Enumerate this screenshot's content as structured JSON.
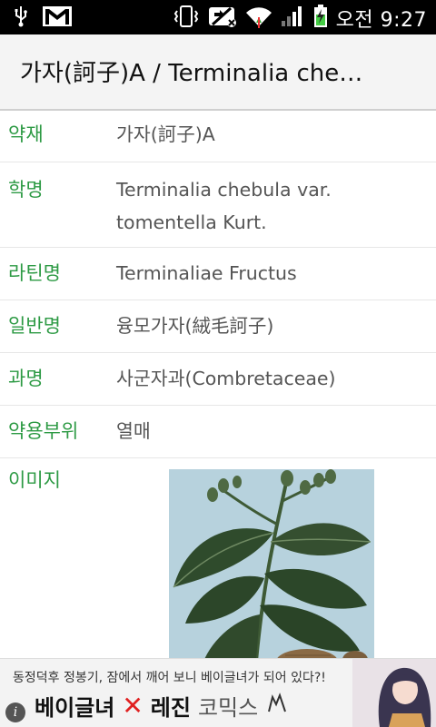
{
  "status_bar": {
    "time": "오전 9:27",
    "icons": [
      "usb-icon",
      "gmail-icon",
      "vibrate-icon",
      "no-sync-icon",
      "wifi-icon",
      "signal-icon",
      "battery-charging-icon"
    ]
  },
  "action_bar": {
    "title": "가자(訶子)A  / Terminalia che…"
  },
  "rows": [
    {
      "label": "약재",
      "value": "가자(訶子)A"
    },
    {
      "label": "학명",
      "value_line1": "Terminalia chebula var.",
      "value_line2": "tomentella Kurt."
    },
    {
      "label": "라틴명",
      "value": "Terminaliae Fructus"
    },
    {
      "label": "일반명",
      "value": "융모가자(絨毛訶子)"
    },
    {
      "label": "과명",
      "value": "사군자과(Combretaceae)"
    },
    {
      "label": "약용부위",
      "value": "열매"
    },
    {
      "label": "이미지"
    }
  ],
  "ad": {
    "headline": "동정덕후 정봉기, 잠에서 깨어 보니 베이글녀가 되어 있다?!",
    "brand1": "베이글녀",
    "x_mark": "✕",
    "brand2": "레진",
    "brand3": "코믹스"
  },
  "colors": {
    "label_green": "#2d9a44",
    "value_gray": "#555555",
    "ad_x_red": "#e02020"
  }
}
